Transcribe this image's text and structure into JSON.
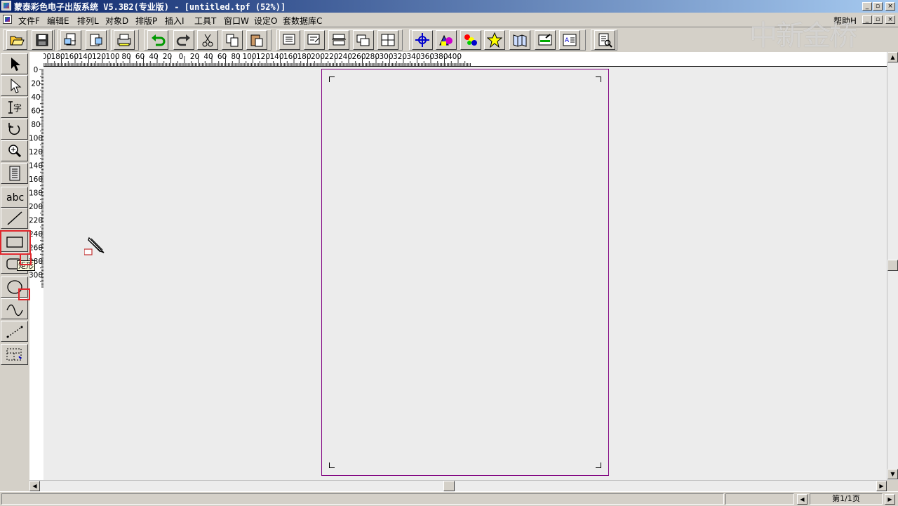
{
  "window": {
    "title": "蒙泰彩色电子出版系统 V5.3B2(专业版) - [untitled.tpf (52%)]",
    "help_label": "帮助H"
  },
  "menu": {
    "items": [
      "文件F",
      "编辑E",
      "排列L",
      "对象D",
      "排版P",
      "插入I",
      "工具T",
      "窗口W",
      "设定O",
      "套数据库C"
    ]
  },
  "watermark": "中新金桥",
  "toolbar": {
    "buttons": [
      "open-icon",
      "save-icon",
      "import-icon",
      "export-icon",
      "print-icon",
      "undo-icon",
      "redo-icon",
      "cut-icon",
      "copy-icon",
      "paste-icon",
      "bring-front-icon",
      "send-back-icon",
      "align-icon",
      "group-icon",
      "ungroup-icon",
      "move-cross-icon",
      "shape-fill-icon",
      "color-palette-icon",
      "star-icon",
      "map-icon",
      "image-edit-icon",
      "text-frame-icon",
      "preview-icon"
    ]
  },
  "toolbox": {
    "tools": [
      "arrow-select-icon",
      "node-select-icon",
      "text-tool-icon",
      "rotate-tool-icon",
      "zoom-tool-icon",
      "page-tool-icon",
      "abc-text-icon",
      "line-tool-icon",
      "rectangle-tool-icon",
      "rounded-rect-tool-icon",
      "ellipse-tool-icon",
      "bezier-tool-icon",
      "dotted-line-tool-icon",
      "table-tool-icon"
    ],
    "abc_label": "abc",
    "text_tool_label": "字",
    "tooltip": "矩形"
  },
  "ruler_top": {
    "labels": [
      "200",
      "180",
      "160",
      "140",
      "120",
      "100",
      "80",
      "60",
      "40",
      "20",
      "0",
      "20",
      "40",
      "60",
      "80",
      "100",
      "120",
      "140",
      "160",
      "180",
      "200",
      "220",
      "240",
      "260",
      "280",
      "300",
      "320",
      "340",
      "360",
      "380",
      "400"
    ]
  },
  "ruler_left": {
    "labels": [
      "0",
      "20",
      "40",
      "60",
      "80",
      "100",
      "120",
      "140",
      "160",
      "180",
      "200",
      "220",
      "240",
      "260",
      "280",
      "300"
    ]
  },
  "status": {
    "page_indicator": "第1/1页"
  },
  "colors": {
    "title_start": "#0a246a",
    "title_end": "#a6caf0",
    "page_border": "#800080",
    "highlight": "#e0262b"
  }
}
